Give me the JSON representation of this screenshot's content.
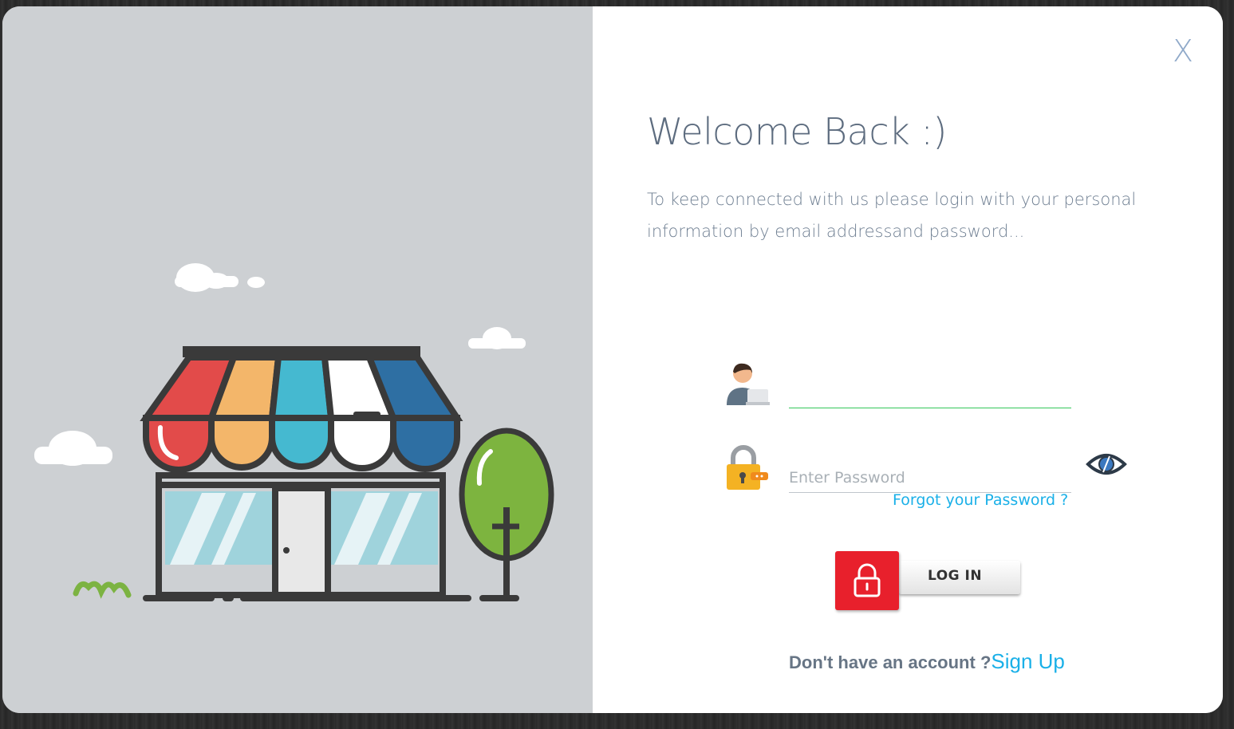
{
  "modal": {
    "close_label": "X",
    "title": "Welcome Back :)",
    "subtitle": "To keep connected with us please login with your personal information by email addressand password..."
  },
  "form": {
    "username": {
      "value": "",
      "placeholder": "",
      "icon": "user-avatar-icon"
    },
    "password": {
      "value": "",
      "placeholder": "Enter Password",
      "icon": "padlock-icon"
    },
    "show_password_icon": "eye-icon",
    "forgot_label": "Forgot your Password ?",
    "login_label": "LOG IN"
  },
  "footer": {
    "prompt": "Don't have an account ?",
    "signup_label": "Sign Up"
  },
  "colors": {
    "accent": "#1ab0e8",
    "login_red": "#e8202c",
    "panel_gray": "#cdd0d3",
    "title_text": "#5d6c7f"
  }
}
